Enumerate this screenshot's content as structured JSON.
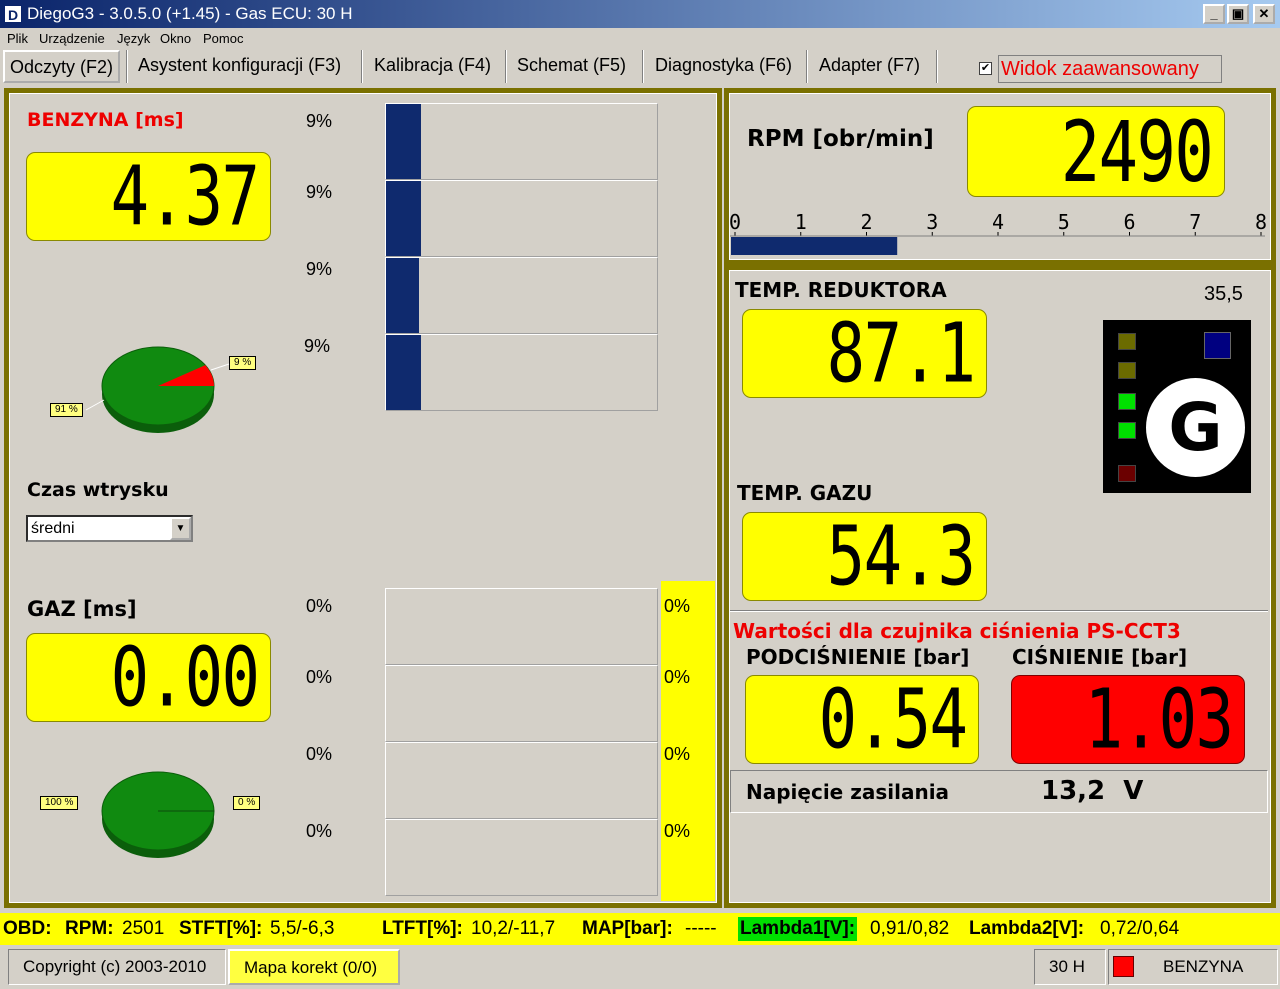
{
  "window": {
    "title": "DiegoG3 - 3.0.5.0 (+1.45) - Gas ECU: 30 H",
    "icon_letter": "D",
    "minimize": "_",
    "maximize": "▣",
    "close": "✕"
  },
  "menu": [
    "Plik",
    "Urządzenie",
    "Język",
    "Okno",
    "Pomoc"
  ],
  "tabs": [
    "Odczyty (F2)",
    "Asystent konfiguracji (F3)",
    "Kalibracja (F4)",
    "Schemat (F5)",
    "Diagnostyka (F6)",
    "Adapter (F7)"
  ],
  "advanced_view": {
    "checked": true,
    "check_mark": "✔",
    "label": "Widok zaawansowany"
  },
  "benzyna": {
    "label": "BENZYNA [ms]",
    "value": "4.37",
    "bars": [
      {
        "label": "9%",
        "fill": 0.13
      },
      {
        "label": "9%",
        "fill": 0.13
      },
      {
        "label": "9%",
        "fill": 0.12
      },
      {
        "label": "9%",
        "fill": 0.13
      }
    ],
    "pie": {
      "slice_pct": 9,
      "slice_label": "9 %",
      "rest_label": "91 %"
    }
  },
  "czas_wtrysku": {
    "label": "Czas wtrysku",
    "selected": "średni"
  },
  "gaz": {
    "label": "GAZ [ms]",
    "value": "0.00",
    "bars": [
      {
        "label": "0%",
        "fill": 0
      },
      {
        "label": "0%",
        "fill": 0
      },
      {
        "label": "0%",
        "fill": 0
      },
      {
        "label": "0%",
        "fill": 0
      }
    ],
    "side_labels": [
      "0%",
      "0%",
      "0%",
      "0%"
    ],
    "pie": {
      "slice_pct": 0,
      "slice_label": "0 %",
      "rest_label": "100 %"
    }
  },
  "rpm": {
    "label": "RPM [obr/min]",
    "value": "2490",
    "scale_labels": [
      "0",
      "1",
      "2",
      "3",
      "4",
      "5",
      "6",
      "7",
      "8"
    ],
    "scale_max": 8,
    "value_thousands": 2.49
  },
  "temp_reduktora": {
    "label": "TEMP. REDUKTORA",
    "value": "87.1",
    "aux_value": "35,5"
  },
  "indicator": {
    "badge": "G",
    "leds": [
      "#6b6b00",
      "#6b6b00",
      "#00e000",
      "#00e000",
      "#6b0000"
    ],
    "corner_color": "#000080"
  },
  "temp_gazu": {
    "label": "TEMP. GAZU",
    "value": "54.3"
  },
  "pressure": {
    "title": "Wartości dla czujnika ciśnienia PS-CCT3",
    "vacuum_label": "PODCIŚNIENIE [bar]",
    "vacuum_value": "0.54",
    "pressure_label": "CIŚNIENIE [bar]",
    "pressure_value": "1.03",
    "pressure_color": "#ff0000"
  },
  "voltage": {
    "label": "Napięcie zasilania",
    "value": "13,2  V"
  },
  "obd": {
    "prefix": "OBD:",
    "rpm_label": "RPM:",
    "rpm": "2501",
    "stft_label": "STFT[%]:",
    "stft": "5,5/-6,3",
    "ltft_label": "LTFT[%]:",
    "ltft": "10,2/-11,7",
    "map_label": "MAP[bar]:",
    "map": "-----",
    "lambda1_label": "Lambda1[V]:",
    "lambda1": "0,91/0,82",
    "lambda2_label": "Lambda2[V]:",
    "lambda2": "0,72/0,64"
  },
  "status": {
    "copyright": "Copyright (c) 2003-2010",
    "map_button": "Mapa korekt (0/0)",
    "ecu": "30 H",
    "fuel_color": "#ff0000",
    "fuel": "BENZYNA"
  }
}
